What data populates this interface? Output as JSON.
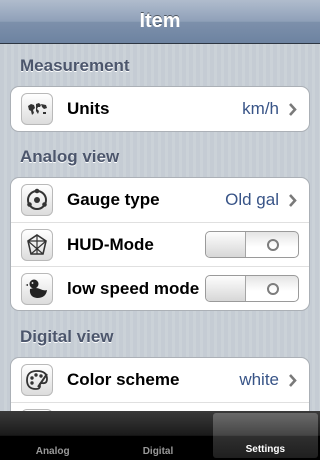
{
  "navbar": {
    "title": "Item"
  },
  "sections": {
    "measurement": {
      "header": "Measurement",
      "rows": [
        {
          "label": "Units",
          "value": "km/h",
          "icon": "world-map-icon"
        }
      ]
    },
    "analog": {
      "header": "Analog view",
      "rows": [
        {
          "label": "Gauge type",
          "value": "Old gal",
          "icon": "gauge-icon"
        },
        {
          "label": "HUD-Mode",
          "toggle_state": "off",
          "icon": "hud-glass-icon"
        },
        {
          "label": "low speed mode",
          "toggle_state": "off",
          "icon": "duck-icon"
        }
      ]
    },
    "digital": {
      "header": "Digital view",
      "rows": [
        {
          "label": "Color scheme",
          "value": "white",
          "icon": "palette-icon"
        }
      ]
    }
  },
  "tabbar": {
    "tabs": [
      {
        "label": "Analog",
        "active": false
      },
      {
        "label": "Digital",
        "active": false
      },
      {
        "label": "Settings",
        "active": true
      }
    ]
  },
  "colors": {
    "value_text": "#385487",
    "section_header": "#4c566c",
    "navbar": "#6d83a1"
  }
}
